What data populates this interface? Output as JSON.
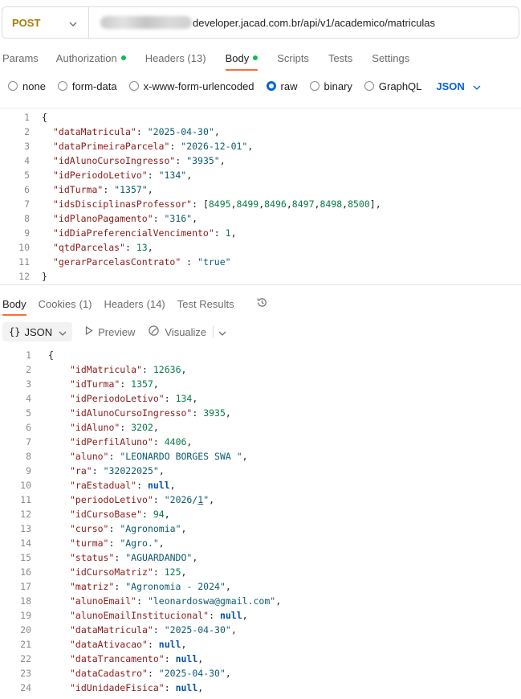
{
  "request": {
    "method": "POST",
    "url_visible": "developer.jacad.com.br/api/v1/academico/matriculas"
  },
  "request_tabs": [
    {
      "label": "Params",
      "active": false,
      "dot": false
    },
    {
      "label": "Authorization",
      "active": false,
      "dot": true
    },
    {
      "label": "Headers (13)",
      "active": false,
      "dot": false
    },
    {
      "label": "Body",
      "active": true,
      "dot": true
    },
    {
      "label": "Scripts",
      "active": false,
      "dot": false
    },
    {
      "label": "Tests",
      "active": false,
      "dot": false
    },
    {
      "label": "Settings",
      "active": false,
      "dot": false
    }
  ],
  "body_types": [
    {
      "label": "none",
      "selected": false
    },
    {
      "label": "form-data",
      "selected": false
    },
    {
      "label": "x-www-form-urlencoded",
      "selected": false
    },
    {
      "label": "raw",
      "selected": true
    },
    {
      "label": "binary",
      "selected": false
    },
    {
      "label": "GraphQL",
      "selected": false
    }
  ],
  "body_format": "JSON",
  "request_body_lines": [
    "{",
    "\"dataMatricula\": \"2025-04-30\",",
    "\"dataPrimeiraParcela\": \"2026-12-01\",",
    "\"idAlunoCursoIngresso\": \"3935\",",
    "\"idPeriodoLetivo\": \"134\",",
    "\"idTurma\": \"1357\",",
    "\"idsDisciplinasProfessor\": [8495,8499,8496,8497,8498,8500],",
    "\"idPlanoPagamento\": \"316\",",
    "\"idDiaPreferencialVencimento\": 1,",
    "\"qtdParcelas\": 13,",
    "\"gerarParcelasContrato\" : \"true\"",
    "}"
  ],
  "response_tabs": [
    {
      "label": "Body",
      "count": ""
    },
    {
      "label": "Cookies",
      "count": "(1)"
    },
    {
      "label": "Headers",
      "count": "(14)"
    },
    {
      "label": "Test Results",
      "count": ""
    }
  ],
  "response_toolbar": {
    "format_brace": "{}",
    "format_label": "JSON",
    "preview_label": "Preview",
    "visualize_label": "Visualize"
  },
  "response_body_lines": [
    "{",
    "\"idMatricula\": 12636,",
    "\"idTurma\": 1357,",
    "\"idPeriodoLetivo\": 134,",
    "\"idAlunoCursoIngresso\": 3935,",
    "\"idAluno\": 3202,",
    "\"idPerfilAluno\": 4406,",
    "\"aluno\": \"LEONARDO BORGES SWA \",",
    "\"ra\": \"32022025\",",
    "\"raEstadual\": null,",
    "\"periodoLetivo\": \"2026/1\",",
    "\"idCursoBase\": 94,",
    "\"curso\": \"Agronomia\",",
    "\"turma\": \"Agro.\",",
    "\"status\": \"AGUARDANDO\",",
    "\"idCursoMatriz\": 125,",
    "\"matriz\": \"Agronomia - 2024\",",
    "\"alunoEmail\": \"leonardoswa@gmail.com\",",
    "\"alunoEmailInstitucional\": null,",
    "\"dataMatricula\": \"2025-04-30\",",
    "\"dataAtivacao\": null,",
    "\"dataTrancamento\": null,",
    "\"dataCadastro\": \"2025-04-30\",",
    "\"idUnidadeFisica\": null,"
  ],
  "colors": {
    "method": "#ad7a03",
    "active_tab_underline": "#ff6c37",
    "tab_dot": "#0cbb52",
    "accent_blue": "#0265d2",
    "json_key": "#8a1a1a",
    "json_string": "#0e5a6c",
    "json_number": "#0a7a4a",
    "json_null": "#0551a8"
  }
}
